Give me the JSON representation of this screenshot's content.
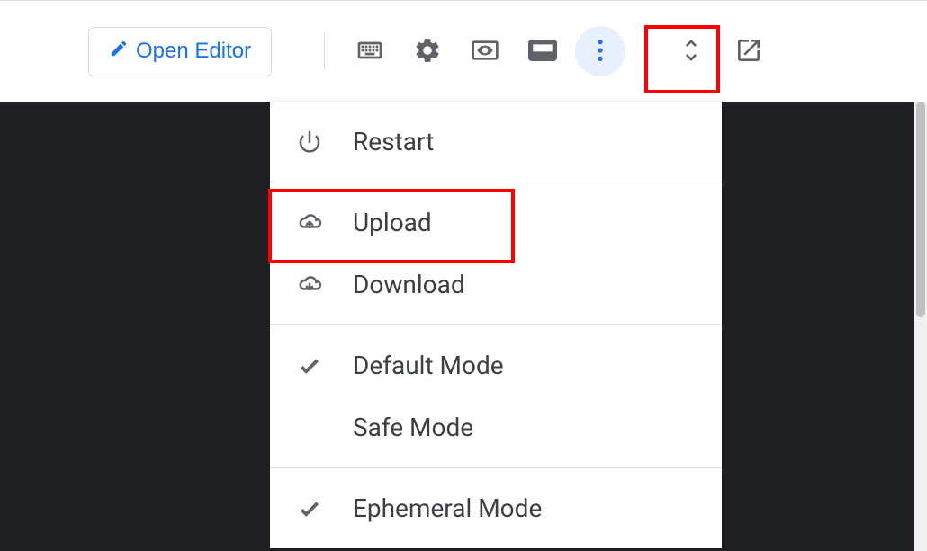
{
  "toolbar": {
    "open_editor_label": "Open Editor"
  },
  "menu": {
    "restart": "Restart",
    "upload": "Upload",
    "download": "Download",
    "default_mode": "Default Mode",
    "safe_mode": "Safe Mode",
    "ephemeral_mode": "Ephemeral Mode"
  }
}
